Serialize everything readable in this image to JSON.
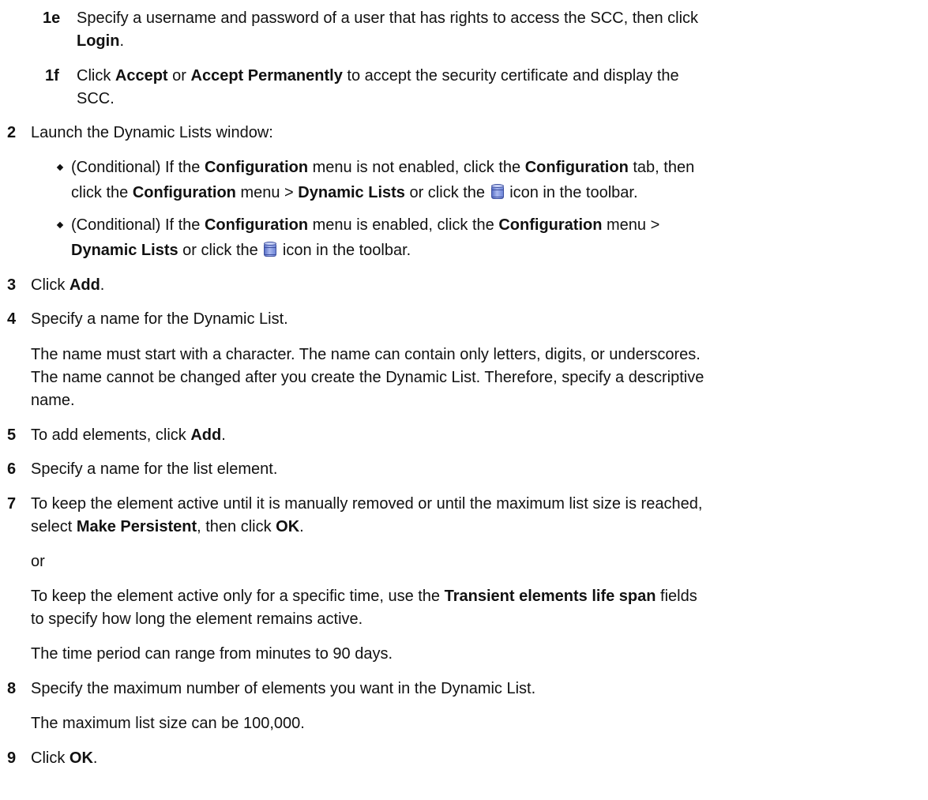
{
  "steps": {
    "s1e": {
      "num": "1e",
      "line1": "Specify a username and password of a user that has rights to access the SCC, then click",
      "login": "Login",
      "period": "."
    },
    "s1f": {
      "num": "1f",
      "click": "Click",
      "accept": "Accept",
      "or": "or",
      "accept_perm": "Accept Permanently",
      "rest1": "to accept the security certificate and display the",
      "line2": "SCC."
    },
    "s2": {
      "num": "2",
      "text": "Launch the Dynamic Lists window:",
      "b1": {
        "cond": "(Conditional) If the",
        "config": "Configuration",
        "not_enabled": "menu is not enabled, click the",
        "config2": "Configuration",
        "tab_then": "tab, then",
        "click_the": "click the",
        "config3": "Configuration",
        "menu_gt": "menu >",
        "dyn_lists": "Dynamic Lists",
        "or_click": "or click the",
        "icon_toolbar": "icon in the toolbar."
      },
      "b2": {
        "cond": "(Conditional) If the",
        "config": "Configuration",
        "enabled": "menu is enabled, click the",
        "config2": "Configuration",
        "menu_gt": "menu >",
        "dyn_lists": "Dynamic Lists",
        "or_click": "or click the",
        "icon_toolbar": "icon in the toolbar."
      }
    },
    "s3": {
      "num": "3",
      "click": "Click",
      "add": "Add",
      "period": "."
    },
    "s4": {
      "num": "4",
      "text": "Specify a name for the Dynamic List.",
      "p1": "The name must start with a character. The name can contain only letters, digits, or underscores.",
      "p2": "The name cannot be changed after you create the Dynamic List. Therefore, specify a descriptive",
      "p3": "name."
    },
    "s5": {
      "num": "5",
      "text": "To add elements, click",
      "add": "Add",
      "period": "."
    },
    "s6": {
      "num": "6",
      "text": "Specify a name for the list element."
    },
    "s7": {
      "num": "7",
      "line1": "To keep the element active until it is manually removed or until the maximum list size is reached,",
      "select": "select",
      "make_persistent": "Make Persistent",
      "then_click": ", then click",
      "ok": "OK",
      "period": ".",
      "or": "or",
      "p1a": "To keep the element active only for a specific time, use the",
      "transient": "Transient elements life span",
      "p1b": "fields",
      "p2": "to specify how long the element remains active.",
      "p3": "The time period can range from minutes to 90 days."
    },
    "s8": {
      "num": "8",
      "text": "Specify the maximum number of elements you want in the Dynamic List.",
      "p1": "The maximum list size can be 100,000."
    },
    "s9": {
      "num": "9",
      "click": "Click",
      "ok": "OK",
      "period": "."
    }
  },
  "icons": {
    "toolbar_icon": "dynamic-lists-database-icon",
    "bullet": "diamond-bullet-icon"
  },
  "colors": {
    "text": "#111111",
    "icon_blue": "#6f86d8",
    "background": "#ffffff"
  }
}
